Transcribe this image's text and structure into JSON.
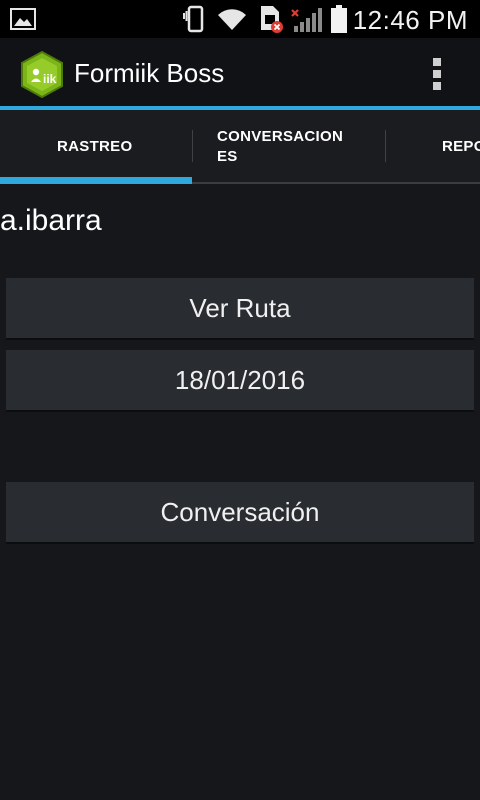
{
  "status_bar": {
    "time": "12:46 PM",
    "icons": [
      "image-notification-icon",
      "vibrate-icon",
      "wifi-icon",
      "sim-error-icon",
      "signal-no-service-icon",
      "battery-icon"
    ]
  },
  "action_bar": {
    "title": "Formiik Boss",
    "logo_text": "iik",
    "accent_color": "#2fa8dc",
    "logo_color": "#7cb518"
  },
  "tabs": [
    {
      "label_line1": "RASTREO",
      "label_line2": "",
      "selected": true
    },
    {
      "label_line1": "CONVERSACION",
      "label_line2": "ES",
      "selected": false
    },
    {
      "label_line1": "REPO",
      "label_line2": "",
      "selected": false
    }
  ],
  "main": {
    "user": "a.ibarra",
    "buttons": {
      "ver_ruta": "Ver Ruta",
      "date": "18/01/2016",
      "conversacion": "Conversación"
    }
  }
}
